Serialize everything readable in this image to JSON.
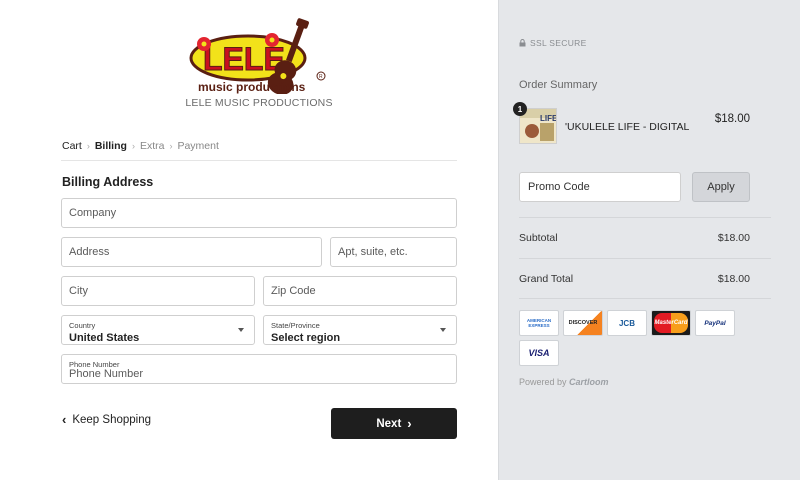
{
  "brand": {
    "logo_word": "LELE",
    "logo_tagline": "music productions",
    "subtitle": "LELE MUSIC PRODUCTIONS"
  },
  "breadcrumb": [
    "Cart",
    "Billing",
    "Extra",
    "Payment"
  ],
  "form": {
    "title": "Billing Address",
    "company_placeholder": "Company",
    "address_placeholder": "Address",
    "apt_placeholder": "Apt, suite, etc.",
    "city_placeholder": "City",
    "zip_placeholder": "Zip Code",
    "country_label": "Country",
    "country_value": "United States",
    "state_label": "State/Province",
    "state_value": "Select region",
    "phone_label": "Phone Number",
    "phone_placeholder": "Phone Number"
  },
  "actions": {
    "keep_shopping": "Keep Shopping",
    "next": "Next"
  },
  "summary": {
    "ssl": "SSL SECURE",
    "title": "Order Summary",
    "item": {
      "qty": "1",
      "name": "'UKULELE LIFE - DIGITAL",
      "price": "$18.00",
      "thumb_text": "LIFE"
    },
    "promo_placeholder": "Promo Code",
    "apply": "Apply",
    "subtotal_label": "Subtotal",
    "subtotal_value": "$18.00",
    "grand_total_label": "Grand Total",
    "grand_total_value": "$18.00",
    "cards": [
      "AMERICAN EXPRESS",
      "DISCOVER",
      "JCB",
      "MasterCard",
      "PayPal",
      "VISA"
    ],
    "powered_prefix": "Powered by",
    "powered_brand": "Cartloom"
  },
  "colors": {
    "accent_dark": "#1e1e1e",
    "sidebar_bg": "#e5e7ea",
    "logo_yellow": "#f2e21a",
    "logo_red": "#d3132a",
    "logo_brown": "#5a1f12"
  }
}
